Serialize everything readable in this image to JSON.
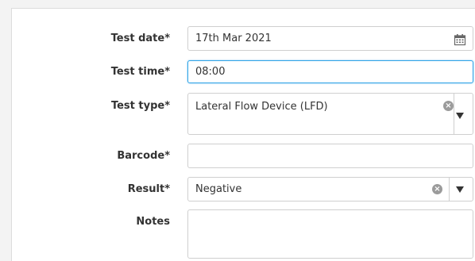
{
  "form": {
    "test_date": {
      "label": "Test date*",
      "value": "17th Mar 2021"
    },
    "test_time": {
      "label": "Test time*",
      "value": "08:00"
    },
    "test_type": {
      "label": "Test type*",
      "value": "Lateral Flow Device (LFD)"
    },
    "barcode": {
      "label": "Barcode*",
      "value": ""
    },
    "result": {
      "label": "Result*",
      "value": "Negative"
    },
    "notes": {
      "label": "Notes",
      "value": ""
    }
  },
  "icons": {
    "calendar": "calendar-icon",
    "clear": "clear-icon",
    "dropdown": "chevron-down-icon"
  },
  "colors": {
    "focus_border": "#2fa4e7",
    "border": "#cfcfcf",
    "panel_bg": "#ffffff",
    "page_bg": "#f3f3f3"
  }
}
